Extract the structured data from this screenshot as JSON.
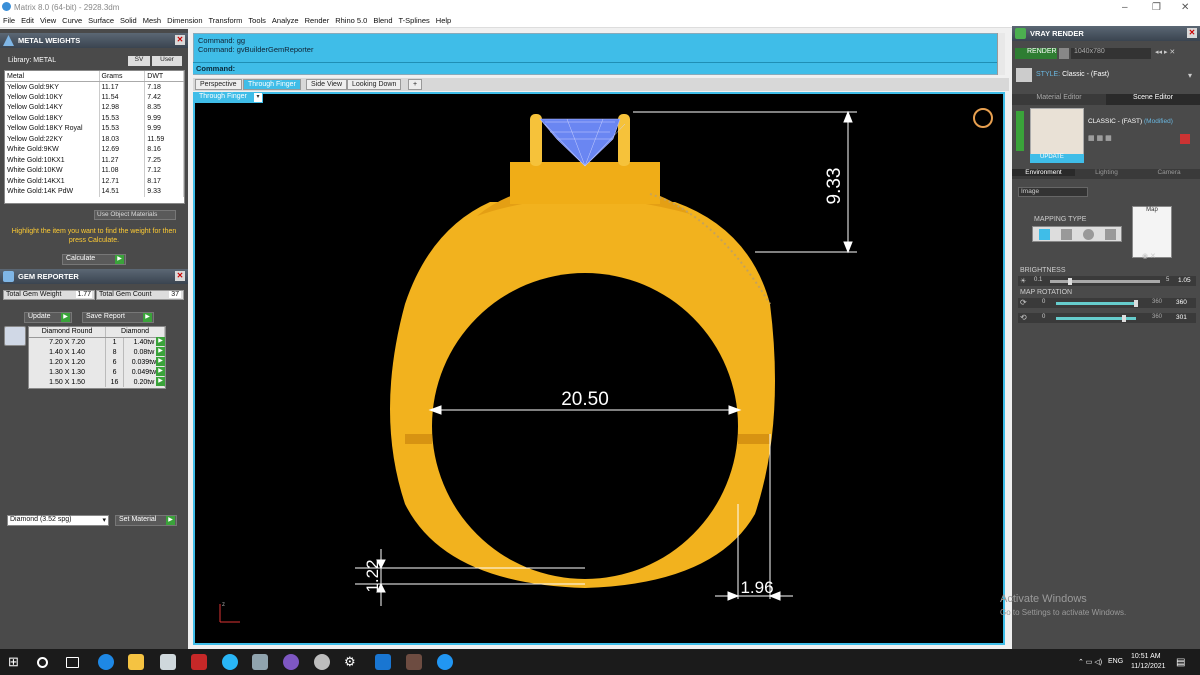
{
  "window": {
    "title": "Matrix 8.0 (64-bit) - 2928.3dm"
  },
  "menu": [
    "File",
    "Edit",
    "View",
    "Curve",
    "Surface",
    "Solid",
    "Mesh",
    "Dimension",
    "Transform",
    "Tools",
    "Analyze",
    "Render",
    "Rhino 5.0",
    "Blend",
    "T-Splines",
    "Help"
  ],
  "metal_weights": {
    "title": "METAL WEIGHTS",
    "library_label": "Library: METAL",
    "sv": "SV",
    "user": "User",
    "headers": [
      "Metal",
      "Grams",
      "DWT"
    ],
    "rows": [
      [
        "Yellow Gold:9KY",
        "11.17",
        "7.18"
      ],
      [
        "Yellow Gold:10KY",
        "11.54",
        "7.42"
      ],
      [
        "Yellow Gold:14KY",
        "12.98",
        "8.35"
      ],
      [
        "Yellow Gold:18KY",
        "15.53",
        "9.99"
      ],
      [
        "Yellow Gold:18KY Royal",
        "15.53",
        "9.99"
      ],
      [
        "Yellow Gold:22KY",
        "18.03",
        "11.59"
      ],
      [
        "White Gold:9KW",
        "12.69",
        "8.16"
      ],
      [
        "White Gold:10KX1",
        "11.27",
        "7.25"
      ],
      [
        "White Gold:10KW",
        "11.08",
        "7.12"
      ],
      [
        "White Gold:14KX1",
        "12.71",
        "8.17"
      ],
      [
        "White Gold:14K PdW",
        "14.51",
        "9.33"
      ]
    ],
    "use_object_materials": "Use Object Materials",
    "hint": "Highlight the item you want to find the weight for then press Calculate.",
    "calculate": "Calculate"
  },
  "gem_reporter": {
    "title": "GEM REPORTER",
    "total_weight_label": "Total Gem Weight",
    "total_weight": "1.77",
    "total_count_label": "Total Gem Count",
    "total_count": "37",
    "update": "Update",
    "save_report": "Save Report",
    "headers": [
      "Diamond Round",
      "Diamond"
    ],
    "rows": [
      [
        "7.20 X 7.20",
        "1",
        "1.40tw"
      ],
      [
        "1.40 X 1.40",
        "8",
        "0.08tw"
      ],
      [
        "1.20 X 1.20",
        "6",
        "0.039tw"
      ],
      [
        "1.30 X 1.30",
        "6",
        "0.049tw"
      ],
      [
        "1.50 X 1.50",
        "16",
        "0.20tw"
      ]
    ],
    "material_select": "Diamond   (3.52 spg)",
    "set_material": "Set Material"
  },
  "command": {
    "line1": "Command: gg",
    "line2": "Command: gvBuilderGemReporter",
    "prompt": "Command:"
  },
  "tabs": [
    "Perspective",
    "Through Finger",
    "Side View",
    "Looking Down",
    "+"
  ],
  "viewport": {
    "label": "Through Finger",
    "dims": {
      "top": "9.33",
      "inner": "20.50",
      "bottom_left": "1.22",
      "bottom_right": "1.96"
    },
    "axis": "z"
  },
  "vray": {
    "title": "VRAY RENDER",
    "render": "RENDER",
    "resolution": "1040x780",
    "style_label": "STYLE:",
    "style": "Classic - (Fast)",
    "material_editor": "Material Editor",
    "scene_editor": "Scene Editor",
    "preset": "CLASSIC - (FAST)",
    "modified": "(Modified)",
    "update": "UPDATE",
    "env_tabs": [
      "Environment",
      "Lighting",
      "Camera"
    ],
    "image_select": "Image",
    "mapping_type": "MAPPING TYPE",
    "map": "Map",
    "brightness": "BRIGHTNESS",
    "b_min": "0.1",
    "b_max": "5",
    "b_val": "1.05",
    "map_rotation": "MAP ROTATION",
    "r1_min": "0",
    "r1_max": "360",
    "r1_val": "360",
    "r2_min": "0",
    "r2_max": "360",
    "r2_val": "301"
  },
  "watermark": {
    "line1": "Activate Windows",
    "line2": "Go to Settings to activate Windows."
  },
  "taskbar": {
    "lang": "ENG",
    "time": "10:51 AM",
    "date": "11/12/2021"
  }
}
